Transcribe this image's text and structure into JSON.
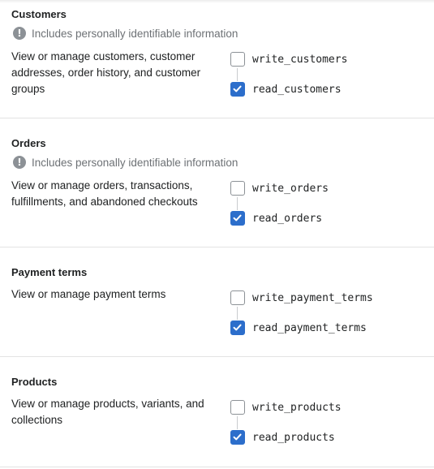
{
  "sections": [
    {
      "title": "Customers",
      "pii_text": "Includes personally identifiable information",
      "description": "View or manage customers, customer addresses, order history, and customer groups",
      "write_scope": {
        "label": "write_customers",
        "checked": false
      },
      "read_scope": {
        "label": "read_customers",
        "checked": true
      }
    },
    {
      "title": "Orders",
      "pii_text": "Includes personally identifiable information",
      "description": "View or manage orders, transactions, fulfillments, and abandoned checkouts",
      "write_scope": {
        "label": "write_orders",
        "checked": false
      },
      "read_scope": {
        "label": "read_orders",
        "checked": true
      }
    },
    {
      "title": "Payment terms",
      "description": "View or manage payment terms",
      "write_scope": {
        "label": "write_payment_terms",
        "checked": false
      },
      "read_scope": {
        "label": "read_payment_terms",
        "checked": true
      }
    },
    {
      "title": "Products",
      "description": "View or manage products, variants, and collections",
      "write_scope": {
        "label": "write_products",
        "checked": false
      },
      "read_scope": {
        "label": "read_products",
        "checked": true
      }
    }
  ],
  "icons": {
    "pii": "info-exclamation-icon",
    "check": "checkmark-icon"
  },
  "colors": {
    "checked": "#2c6ecb",
    "unchecked_border": "#8c9196",
    "subdued_text": "#6d7175"
  }
}
